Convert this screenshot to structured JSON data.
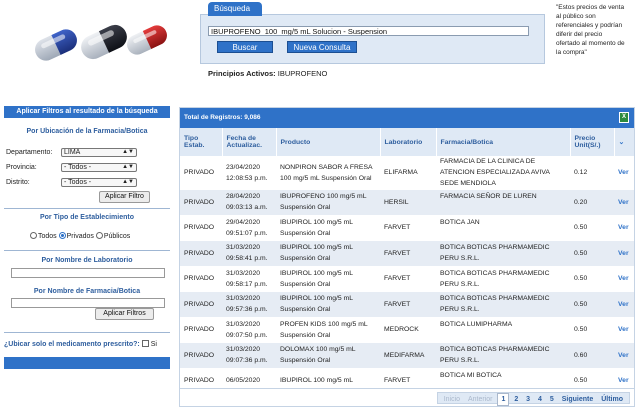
{
  "search": {
    "tab_label": "Búsqueda",
    "input_value": "IBUPROFENO  100  mg/5 mL Solucion - Suspension",
    "buscar_label": "Buscar",
    "nueva_label": "Nueva Consulta",
    "principios_label": "Principios Activos:",
    "principios_value": "IBUPROFENO"
  },
  "note": {
    "l1": "\"Estos precios de venta",
    "l2": "al público son",
    "l3": "referenciales y podrían",
    "l4": "diferir del precio",
    "l5": "ofertado al momento de",
    "l6": "la compra\""
  },
  "sidebar": {
    "header": "Aplicar Filtros al resultado de la búsqueda",
    "ubicacion_title": "Por Ubicación de la Farmacia/Botica",
    "departamento_label": "Departamento:",
    "departamento_value": "LIMA",
    "provincia_label": "Provincia:",
    "provincia_value": "- Todos -",
    "distrito_label": "Distrito:",
    "distrito_value": "- Todos -",
    "aplicar_filtro_label": "Aplicar Filtro",
    "tipo_title": "Por Tipo de Establecimiento",
    "tipo_options": [
      "Todos",
      "Privados",
      "Públicos"
    ],
    "laboratorio_title": "Por Nombre de Laboratorio",
    "farmacia_title": "Por Nombre de Farmacia/Botica",
    "aplicar_filtros_label": "Aplicar Filtros",
    "prescrito_label": "¿Ubicar solo el medicamento prescrito?:",
    "prescrito_si": "Si"
  },
  "results": {
    "total_label": "Total de Registros: 9,086",
    "headers": {
      "tipo_a": "Tipo",
      "tipo_b": "Estab.",
      "fecha_a": "Fecha de",
      "fecha_b": "Actualizac.",
      "producto": "Producto",
      "laboratorio": "Laboratorio",
      "farmacia": "Farmacia/Botica",
      "precio_a": "Precio",
      "precio_b": "Unit(S/.)"
    },
    "rows": [
      {
        "tipo": "PRIVADO",
        "fecha1": "23/04/2020",
        "fecha2": "12:08:53 p.m.",
        "prod1": "NONPIRON SABOR A FRESA",
        "prod2": "100 mg/5 mL Suspensión Oral",
        "lab": "ELIFARMA",
        "farm1": "FARMACIA DE LA CLINICA DE",
        "farm2": "ATENCION ESPECIALIZADA AVIVA",
        "farm3": "SEDE MENDIOLA",
        "precio": "0.12",
        "ver": "Ver"
      },
      {
        "tipo": "PRIVADO",
        "fecha1": "28/04/2020",
        "fecha2": "09:03:13 a.m.",
        "prod1": "IBUPROFENO 100 mg/5 mL",
        "prod2": "Suspensión Oral",
        "lab": "HERSIL",
        "farm1": "FARMACIA SEÑOR DE LUREN",
        "farm2": "",
        "farm3": "",
        "precio": "0.20",
        "ver": "Ver"
      },
      {
        "tipo": "PRIVADO",
        "fecha1": "29/04/2020",
        "fecha2": "09:51:07 p.m.",
        "prod1": "IBUPIROL 100 mg/5 mL",
        "prod2": "Suspensión Oral",
        "lab": "FARVET",
        "farm1": "BOTICA JAN",
        "farm2": "",
        "farm3": "",
        "precio": "0.50",
        "ver": "Ver"
      },
      {
        "tipo": "PRIVADO",
        "fecha1": "31/03/2020",
        "fecha2": "09:58:41 p.m.",
        "prod1": "IBUPIROL 100 mg/5 mL",
        "prod2": "Suspensión Oral",
        "lab": "FARVET",
        "farm1": "BOTICA BOTICAS PHARMAMEDIC",
        "farm2": "PERU S.R.L.",
        "farm3": "",
        "precio": "0.50",
        "ver": "Ver"
      },
      {
        "tipo": "PRIVADO",
        "fecha1": "31/03/2020",
        "fecha2": "09:58:17 p.m.",
        "prod1": "IBUPIROL 100 mg/5 mL",
        "prod2": "Suspensión Oral",
        "lab": "FARVET",
        "farm1": "BOTICA BOTICAS PHARMAMEDIC",
        "farm2": "PERU S.R.L.",
        "farm3": "",
        "precio": "0.50",
        "ver": "Ver"
      },
      {
        "tipo": "PRIVADO",
        "fecha1": "31/03/2020",
        "fecha2": "09:57:36 p.m.",
        "prod1": "IBUPIROL 100 mg/5 mL",
        "prod2": "Suspensión Oral",
        "lab": "FARVET",
        "farm1": "BOTICA BOTICAS PHARMAMEDIC",
        "farm2": "PERU S.R.L.",
        "farm3": "",
        "precio": "0.50",
        "ver": "Ver"
      },
      {
        "tipo": "PRIVADO",
        "fecha1": "31/03/2020",
        "fecha2": "09:07:50 p.m.",
        "prod1": "PROFEN KIDS 100 mg/5 mL",
        "prod2": "Suspensión Oral",
        "lab": "MEDROCK",
        "farm1": "BOTICA LUMIPHARMA",
        "farm2": "",
        "farm3": "",
        "precio": "0.50",
        "ver": "Ver"
      },
      {
        "tipo": "PRIVADO",
        "fecha1": "31/03/2020",
        "fecha2": "09:07:36 p.m.",
        "prod1": "DOLOMAX 100 mg/5 mL",
        "prod2": "Suspensión Oral",
        "lab": "MEDIFARMA",
        "farm1": "BOTICA BOTICAS PHARMAMEDIC",
        "farm2": "PERU S.R.L.",
        "farm3": "",
        "precio": "0.60",
        "ver": "Ver"
      },
      {
        "tipo": "PRIVADO",
        "fecha1": "06/05/2020",
        "fecha2": "",
        "prod1": "IBUPIROL 100 mg/5 mL",
        "prod2": "",
        "lab": "FARVET",
        "farm1": "BOTICA MI BOTICA",
        "farm2": "",
        "farm3": "",
        "precio": "0.50",
        "ver": "Ver"
      }
    ],
    "pager": {
      "inicio": "Inicio",
      "anterior": "Anterior",
      "pages": [
        "1",
        "2",
        "3",
        "4",
        "5"
      ],
      "siguiente": "Siguiente",
      "ultimo": "Último"
    }
  }
}
